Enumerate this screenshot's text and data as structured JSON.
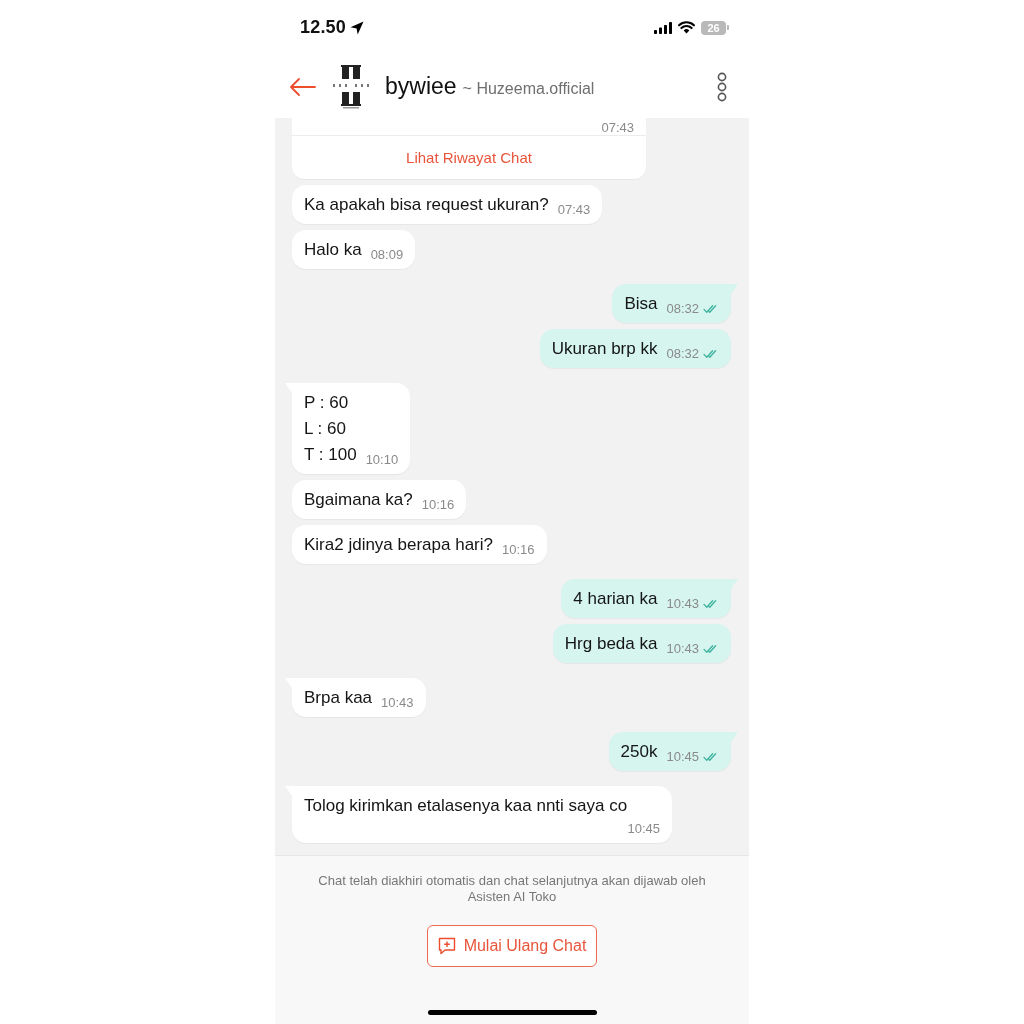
{
  "status_bar": {
    "time": "12.50",
    "battery": "26"
  },
  "header": {
    "name": "bywiee",
    "shop": "~ Huzeema.official"
  },
  "history_card": {
    "time": "07:43",
    "link": "Lihat Riwayat Chat"
  },
  "messages": [
    {
      "kind": "received",
      "text": "Ka apakah bisa request ukuran?",
      "time": "07:43",
      "tail": false
    },
    {
      "kind": "received",
      "text": "Halo ka",
      "time": "08:09",
      "tail": false
    },
    {
      "kind": "sent",
      "text": "Bisa",
      "time": "08:32",
      "tail": true,
      "read": true
    },
    {
      "kind": "sent",
      "text": "Ukuran brp kk",
      "time": "08:32",
      "tail": false,
      "read": true
    },
    {
      "kind": "received",
      "text": "P : 60\nL : 60\nT : 100",
      "time": "10:10",
      "tail": true
    },
    {
      "kind": "received",
      "text": "Bgaimana ka?",
      "time": "10:16",
      "tail": false
    },
    {
      "kind": "received",
      "text": "Kira2 jdinya berapa hari?",
      "time": "10:16",
      "tail": false
    },
    {
      "kind": "sent",
      "text": "4 harian ka",
      "time": "10:43",
      "tail": true,
      "read": true
    },
    {
      "kind": "sent",
      "text": "Hrg beda ka",
      "time": "10:43",
      "tail": false,
      "read": true
    },
    {
      "kind": "received",
      "text": "Brpa kaa",
      "time": "10:43",
      "tail": true
    },
    {
      "kind": "sent",
      "text": "250k",
      "time": "10:45",
      "tail": true,
      "read": true
    },
    {
      "kind": "received",
      "text": "Tolog kirimkan etalasenya kaa nnti saya co",
      "time": "10:45",
      "tail": true
    }
  ],
  "footer": {
    "notice": "Chat telah diakhiri otomatis dan chat selanjutnya akan dijawab oleh Asisten AI Toko",
    "button": "Mulai Ulang Chat"
  }
}
